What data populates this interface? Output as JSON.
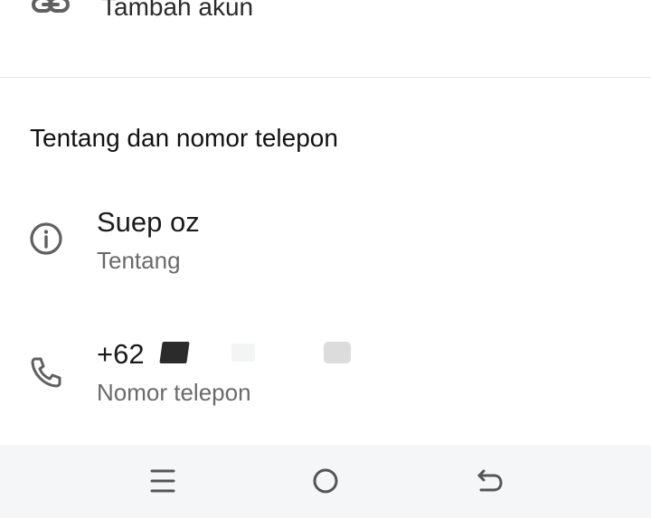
{
  "add_account": {
    "label": "Tambah akun",
    "icon": "link-icon"
  },
  "section": {
    "title": "Tentang dan nomor telepon"
  },
  "about": {
    "value": "Suep oz",
    "label": "Tentang",
    "icon": "info-icon"
  },
  "phone": {
    "value": "+62",
    "label": "Nomor telepon",
    "icon": "phone-icon"
  },
  "nav": {
    "menu_icon": "recent-apps-icon",
    "home_icon": "home-icon",
    "back_icon": "back-icon"
  },
  "colors": {
    "icon": "#606060",
    "secondary_text": "#6a6a6a",
    "nav_background": "#f5f6f8"
  }
}
